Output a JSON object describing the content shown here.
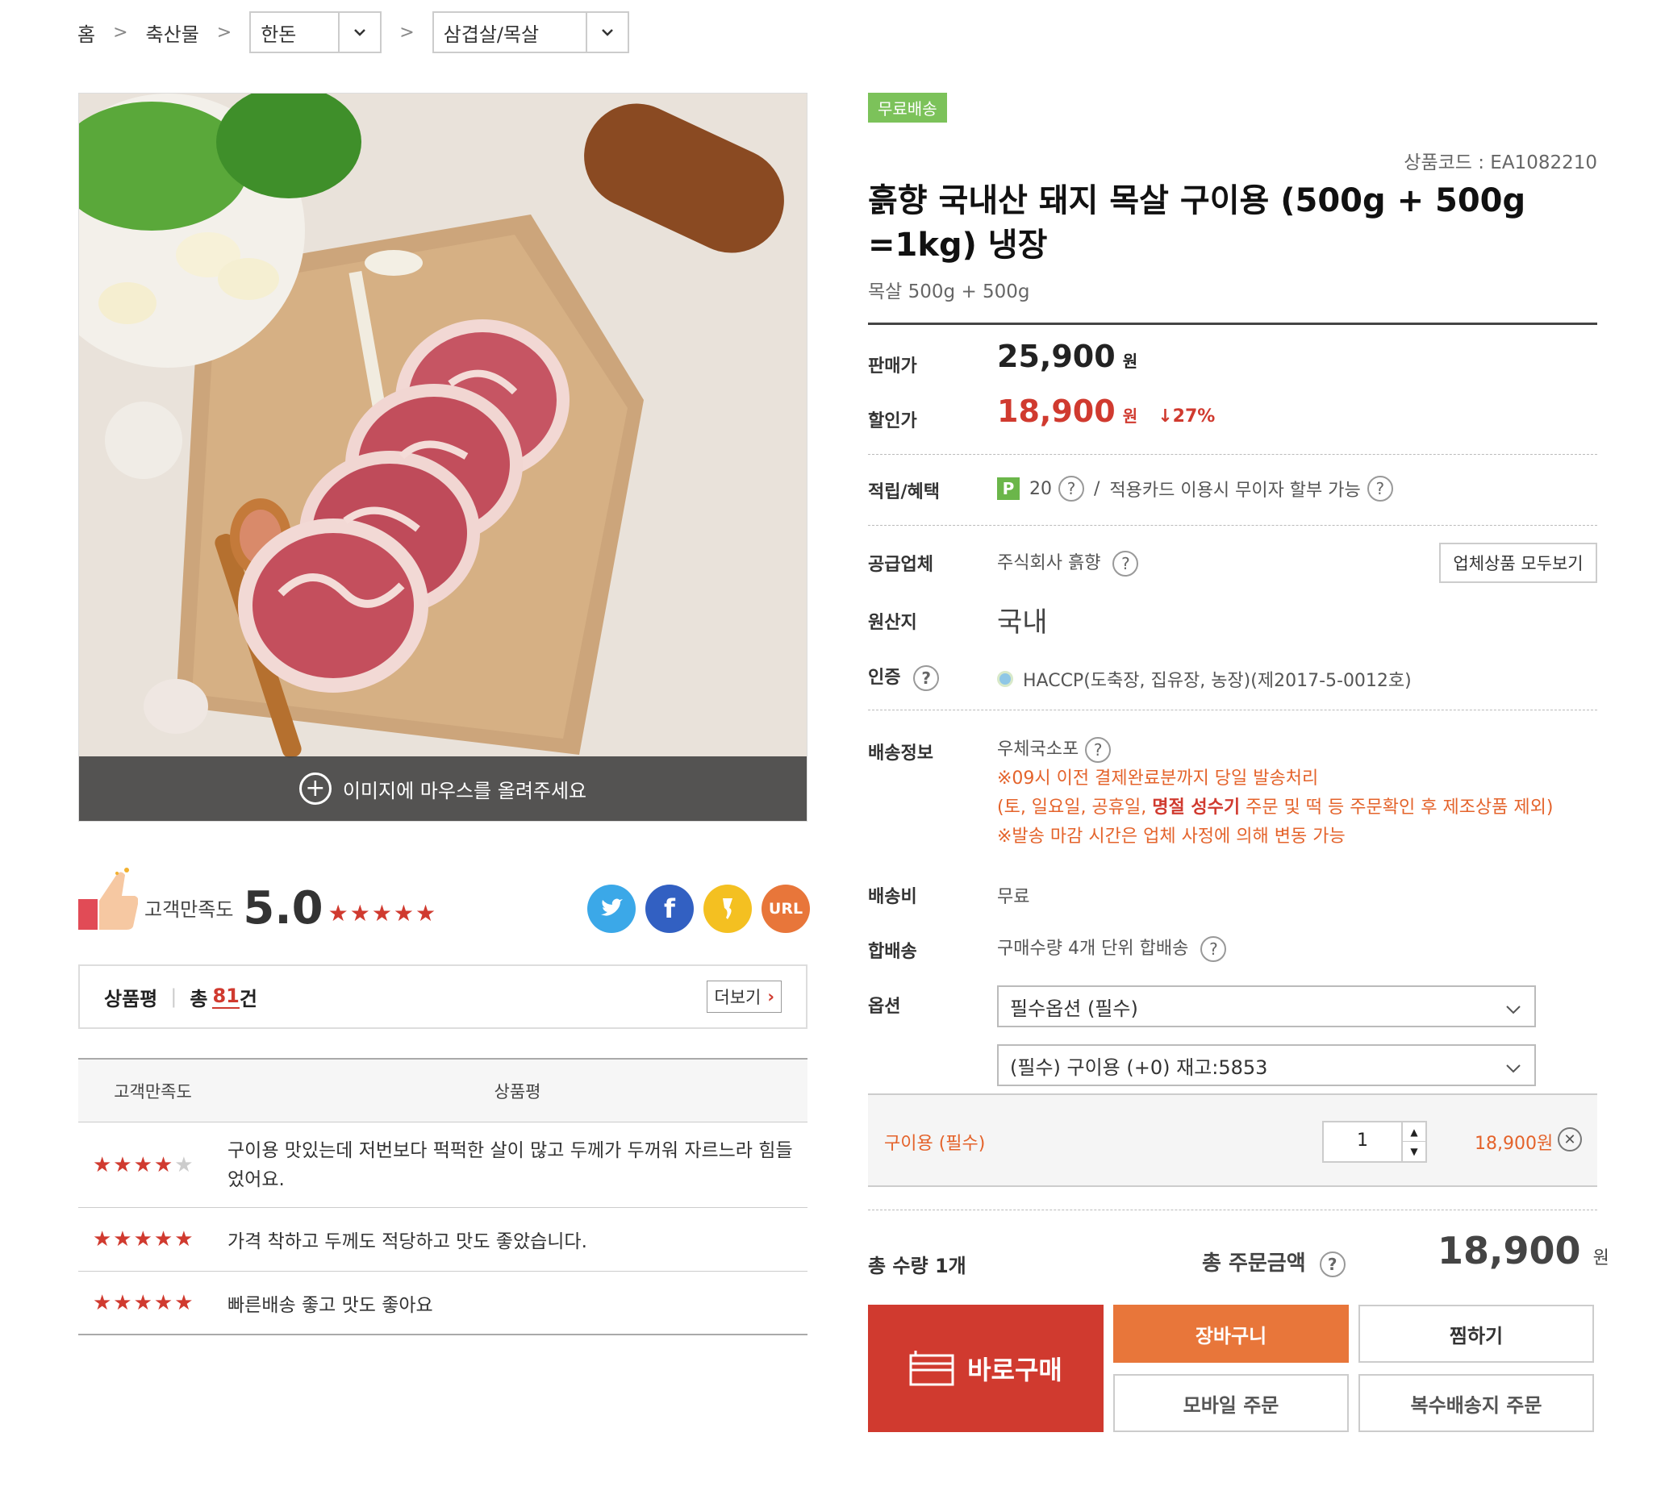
{
  "breadcrumb": {
    "home": "홈",
    "cat1": "축산물",
    "cat2": "한돈",
    "cat3": "삼겹살/목살"
  },
  "image": {
    "hover_text": "이미지에 마우스를 올려주세요"
  },
  "satisfaction": {
    "label": "고객만족도",
    "score": "5.0",
    "stars": "★★★★★"
  },
  "share": {
    "url": "URL"
  },
  "review_summary": {
    "label": "상품평",
    "total_prefix": "총",
    "count": "81",
    "suffix": "건",
    "more": "더보기"
  },
  "review_table": {
    "headers": [
      "고객만족도",
      "상품평"
    ],
    "rows": [
      {
        "stars": "★★★★",
        "empty": "★",
        "text": "구이용 맛있는데 저번보다 퍽퍽한 살이 많고 두께가 두꺼워 자르느라 힘들었어요."
      },
      {
        "stars": "★★★★★",
        "empty": "",
        "text": "가격 착하고 두께도 적당하고 맛도 좋았습니다."
      },
      {
        "stars": "★★★★★",
        "empty": "",
        "text": "빠른배송 좋고 맛도 좋아요"
      }
    ]
  },
  "product": {
    "badge": "무료배송",
    "code": "상품코드 : EA1082210",
    "title": "흙향 국내산 돼지 목살 구이용 (500g + 500g =1kg) 냉장",
    "subtitle": "목살 500g + 500g"
  },
  "price": {
    "sale_label": "판매가",
    "sale": "25,900",
    "won": "원",
    "disc_label": "할인가",
    "disc": "18,900",
    "rate": "↓27%"
  },
  "benefit": {
    "label": "적립/혜택",
    "point_icon": "P",
    "points": "20",
    "slash": "/",
    "card": "적용카드 이용시 무이자 할부 가능"
  },
  "supplier": {
    "label": "공급업체",
    "name": "주식회사 흙향",
    "view_all": "업체상품 모두보기"
  },
  "origin": {
    "label": "원산지",
    "value": "국내"
  },
  "cert": {
    "label": "인증",
    "value": "HACCP(도축장, 집유장, 농장)(제2017-5-0012호)"
  },
  "shipping": {
    "label": "배송정보",
    "method": "우체국소포",
    "note1": "※09시 이전 결제완료분까지 당일 발송처리",
    "note2a": "(토, 일요일, 공휴일, ",
    "note2b": "명절 성수기",
    "note2c": " 주문 및 떡 등 주문확인 후 제조상품 제외)",
    "note3": "※발송 마감 시간은 업체 사정에 의해 변동 가능"
  },
  "ship_fee": {
    "label": "배송비",
    "value": "무료"
  },
  "combined": {
    "label": "합배송",
    "value": "구매수량 4개 단위 합배송"
  },
  "options": {
    "label": "옵션",
    "select1": "필수옵션 (필수)",
    "select2": "(필수) 구이용 (+0) 재고:5853"
  },
  "selected": {
    "name": "구이용 (필수)",
    "qty": "1",
    "price": "18,900원"
  },
  "total": {
    "qty_label": "총 수량 1개",
    "amount_label": "총 주문금액",
    "amount": "18,900",
    "won": "원"
  },
  "buttons": {
    "buy_now": "바로구매",
    "cart": "장바구니",
    "wish": "찜하기",
    "mobile": "모바일 주문",
    "multi": "복수배송지 주문"
  },
  "colors": {
    "accent": "#d03a2f",
    "orange": "#e8763a",
    "green": "#7cc25a"
  }
}
